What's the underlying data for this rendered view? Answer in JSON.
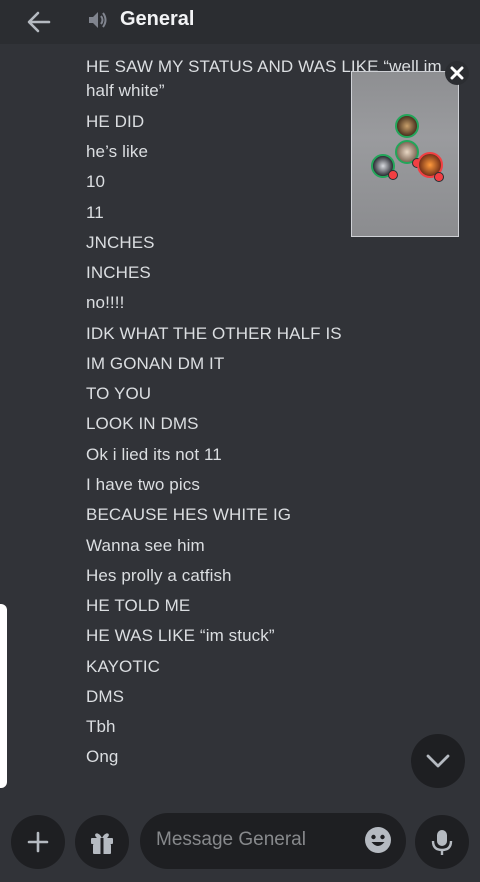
{
  "header": {
    "title": "General",
    "back_icon": "arrow-left-icon",
    "channel_icon": "speaker-icon"
  },
  "messages": [
    "HE SAW MY STATUS AND WAS LIKE “well im",
    "half white”",
    "HE DID",
    "he’s like",
    "10",
    "11",
    "JNCHES",
    "INCHES",
    "no!!!!",
    "IDK WHAT THE OTHER HALF IS",
    "IM GONAN DM IT",
    "TO YOU",
    "LOOK IN DMS",
    "Ok i lied its not 11",
    "I have two pics",
    "BECAUSE HES WHITE IG",
    "Wanna see him",
    "Hes prolly a catfish",
    "HE TOLD ME",
    "HE WAS LIKE “im stuck”",
    "KAYOTIC",
    "DMS",
    "Tbh",
    "Ong"
  ],
  "composer": {
    "placeholder": "Message General",
    "plus_icon": "plus-icon",
    "gift_icon": "gift-icon",
    "emoji_icon": "emoji-icon",
    "mic_icon": "microphone-icon"
  },
  "colors": {
    "background": "#313338",
    "header": "#2b2d31",
    "input": "#1e1f22",
    "text": "#dbdee1",
    "online": "#23a55a",
    "alert": "#f23f43"
  }
}
